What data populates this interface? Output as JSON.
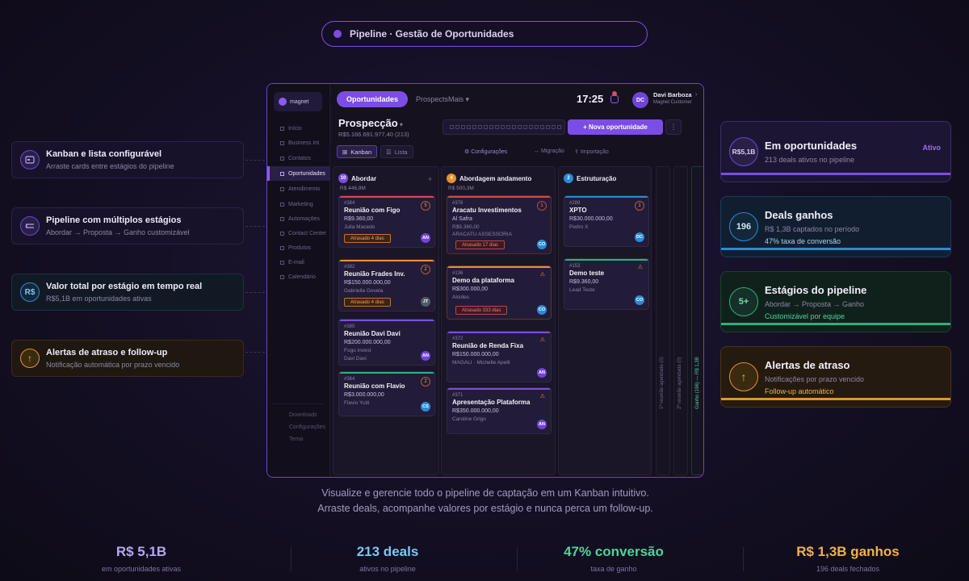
{
  "header": {
    "pill_text": "Pipeline · Gestão de Oportunidades"
  },
  "features": [
    {
      "title": "Kanban e lista configurável",
      "subtitle": "Arraste cards entre estágios do pipeline",
      "icon": "card-icon"
    },
    {
      "title": "Pipeline com múltiplos estágios",
      "subtitle": "Abordar → Proposta → Ganho customizável",
      "icon": "stages-icon"
    },
    {
      "title": "Valor total por estágio em tempo real",
      "subtitle": "R$5,1B em oportunidades ativas",
      "icon_text": "R$"
    },
    {
      "title": "Alertas de atraso e follow-up",
      "subtitle": "Notificação automática por prazo vencido",
      "icon_text": "↑"
    }
  ],
  "stat_cards": [
    {
      "circle": "R$5,1B",
      "title": "Em oportunidades",
      "subtitle": "213 deals ativos no pipeline",
      "tag": "Ativo",
      "accent": "#7c4ee0"
    },
    {
      "circle": "196",
      "title": "Deals ganhos",
      "subtitle": "R$ 1,3B captados no período",
      "note": "47% taxa de conversão",
      "accent": "#2a8ad8"
    },
    {
      "circle": "5+",
      "title": "Estágios do pipeline",
      "subtitle": "Abordar → Proposta → Ganho",
      "note": "Customizável por equipe",
      "accent": "#2fb07a"
    },
    {
      "circle": "↑",
      "title": "Alertas de atraso",
      "subtitle": "Notificações por prazo vencido",
      "note": "Follow-up automático",
      "accent": "#e6932a"
    }
  ],
  "app": {
    "logo": "magnet",
    "nav": [
      "Início",
      "Business Int.",
      "Contatos",
      "Oportunidades",
      "Atendimento",
      "Marketing",
      "Automações",
      "Contact Center",
      "Produtos",
      "E-mail",
      "Calendário"
    ],
    "nav_bottom": [
      "Downloads",
      "Configurações",
      "Tema"
    ],
    "tab_active": "Oportunidades",
    "tab_other": "ProspectsMais",
    "clock": "17:25",
    "user_initials": "DC",
    "user_name": "Davi Barboza",
    "user_role": "Magnet Customer",
    "page_title": "Prospecção",
    "page_sub": "R$5.166.691.977,40 (213)",
    "new_button": "+ Nova oportunidade",
    "more": "⋮",
    "view_kanban": "Kanban",
    "view_list": "Lista",
    "tool_config": "Configurações",
    "tool_migration": "Migração",
    "tool_import": "Importação",
    "columns": [
      {
        "count": "10",
        "name": "Abordar",
        "value": "R$ 446,9M",
        "color": "#7c4ee0",
        "cards": [
          {
            "id": "#384",
            "title": "Reunião com Figo",
            "value": "R$9.360,00",
            "contact": "Julia Macedo",
            "late": "Atrasado 4 dias",
            "badge": "5",
            "avatar": "AN"
          },
          {
            "id": "#382",
            "title": "Reunião Frades Inv.",
            "value": "R$150.000.000,00",
            "contact": "Gabriella Govela",
            "late": "Atrasado 4 dias",
            "badge": "2",
            "avatar": "JT"
          },
          {
            "id": "#380",
            "title": "Reunião Davi Davi",
            "value": "R$200.000.000,00",
            "contact": "Fogo invest",
            "contact2": "Davi Davi",
            "avatar": "AN"
          },
          {
            "id": "#364",
            "title": "Reunião com Flavio",
            "value": "R$3.000.000,00",
            "contact": "Flavio Yuiti",
            "badge": "2",
            "avatar": "CS"
          }
        ]
      },
      {
        "count": "4",
        "name": "Abordagem andamento",
        "value": "R$ 500,3M",
        "color": "#e6932a",
        "cards": [
          {
            "id": "#376",
            "title": "Aracatu Investimentos",
            "value": "Al Safra",
            "contact": "R$9.360,00",
            "contact2": "ARACATU ASSESSORIA",
            "late": "Atrasado 17 dias",
            "badge": "1",
            "avatar": "CO"
          },
          {
            "id": "#136",
            "title": "Demo da plataforma",
            "value": "R$300.000,00",
            "contact": "Alcides",
            "late": "Atrasado 333 dias",
            "avatar": "CO"
          },
          {
            "id": "#372",
            "title": "Reunião de Renda Fixa",
            "value": "R$150.000.000,00",
            "contact": "MAGALI · Michelle Apelli",
            "avatar": "AN"
          },
          {
            "id": "#371",
            "title": "Apresentação Plataforma",
            "value": "R$350.000.000,00",
            "contact": "Caroline Grigo",
            "avatar": "AN"
          }
        ]
      },
      {
        "count": "2",
        "name": "Estruturação",
        "value": "",
        "color": "#2a8ad8",
        "cards": [
          {
            "id": "#289",
            "title": "XPTO",
            "value": "R$30.000.000,00",
            "contact": "Pedro X",
            "badge": "1",
            "avatar": "DC"
          },
          {
            "id": "#153",
            "title": "Demo teste",
            "value": "R$9.360,00",
            "contact": "Lead Teste",
            "avatar": "CO"
          }
        ]
      }
    ],
    "vertical_cols": [
      "1ª reunião agendada (0)",
      "2ª reunião agendada (0)",
      "Ganho (196) — R$ 1,3B"
    ]
  },
  "caption": {
    "line1": "Visualize e gerencie todo o pipeline de captação em um Kanban intuitivo.",
    "line2": "Arraste deals, acompanhe valores por estágio e nunca perca um follow-up."
  },
  "bottom_stats": [
    {
      "value": "R$ 5,1B",
      "label": "em oportunidades ativas",
      "color": "#b9a4f5"
    },
    {
      "value": "213 deals",
      "label": "ativos no pipeline",
      "color": "#7ec6f0"
    },
    {
      "value": "47% conversão",
      "label": "taxa de ganho",
      "color": "#4fd39a"
    },
    {
      "value": "R$ 1,3B ganhos",
      "label": "196 deals fechados",
      "color": "#f0b24a"
    }
  ]
}
